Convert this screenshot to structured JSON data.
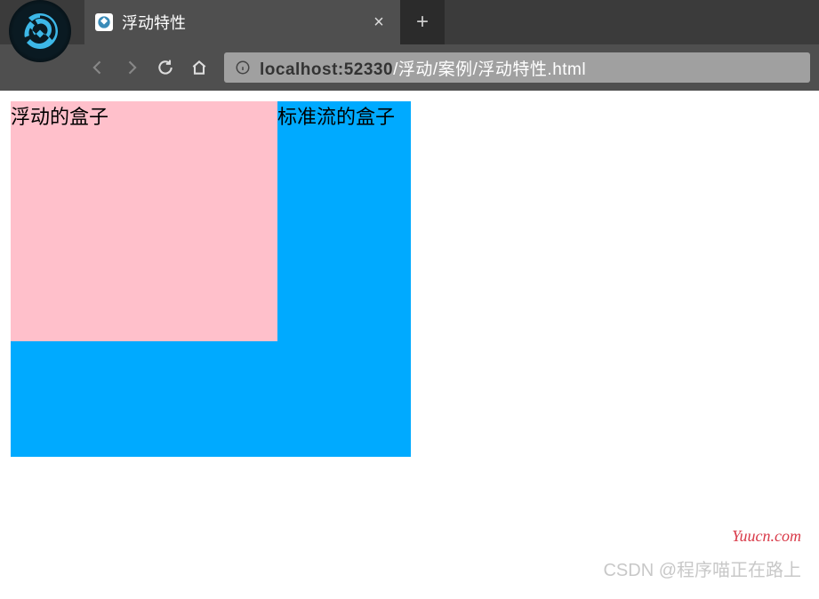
{
  "tab": {
    "title": "浮动特性",
    "close": "×",
    "new_tab": "+"
  },
  "address": {
    "host": "localhost:52330",
    "path": "/浮动/案例/浮动特性.html"
  },
  "page": {
    "float_box_label": "浮动的盒子",
    "standard_box_label": "标准流的盒子"
  },
  "watermarks": {
    "yuucn": "Yuucn.com",
    "csdn": "CSDN @程序喵正在路上"
  },
  "colors": {
    "float_box": "#ffc0cb",
    "standard_box": "#00aaff",
    "tab_bg": "#4f4f4f",
    "chrome_bg": "#3b3b3b"
  }
}
